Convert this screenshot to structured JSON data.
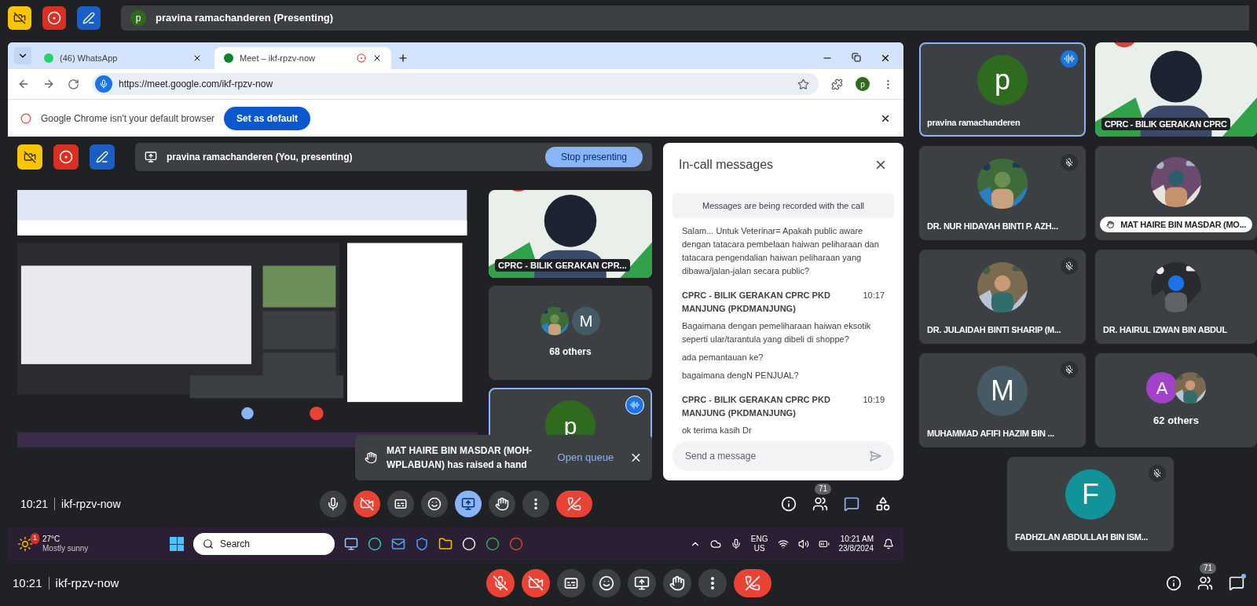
{
  "top_bar": {
    "initial": "p",
    "title": "pravina ramachanderen (Presenting)"
  },
  "browser": {
    "tabs": [
      {
        "label": "(46) WhatsApp",
        "selected": false,
        "recording": false
      },
      {
        "label": "Meet – ikf-rpzv-now",
        "selected": true,
        "recording": true
      }
    ],
    "url": "https://meet.google.com/ikf-rpzv-now",
    "profile_initial": "p",
    "infobar": {
      "text": "Google Chrome isn't your default browser",
      "button": "Set as default"
    }
  },
  "inner_meet": {
    "presenting_text": "pravina ramachanderen (You, presenting)",
    "stop_button": "Stop presenting",
    "tiles": [
      {
        "kind": "video",
        "name": "CPRC - BILIK GERAKAN CPR..."
      },
      {
        "kind": "others",
        "initial": "M",
        "color": "#455a64",
        "label": "68 others"
      },
      {
        "kind": "initial",
        "initial": "p",
        "color": "#2e6b1f",
        "speaking": true
      }
    ],
    "toast": {
      "text": "MAT HAIRE BIN MASDAR (MOH-WPLABUAN) has raised a hand",
      "action": "Open queue"
    },
    "chat": {
      "title": "In-call messages",
      "notice": "Messages are being recorded with the call",
      "messages": [
        {
          "lines": [
            "Salam... Untuk Veterinar= Apakah public aware dengan tatacara pembelaan haiwan peliharaan dan tatacara pengendalian haiwan peliharaan yang dibawa/jalan-jalan secara public?"
          ]
        },
        {
          "sender": "CPRC - BILIK GERAKAN CPRC PKD MANJUNG (PKDMANJUNG)",
          "time": "10:17",
          "lines": [
            "Bagaimana dengan pemeliharaan haiwan eksotik seperti ular/tarantula yang dibeli di shoppe?",
            "ada pemantauan ke?",
            "bagaimana dengN PENJUAL?"
          ]
        },
        {
          "sender": "CPRC - BILIK GERAKAN CPRC PKD MANJUNG (PKDMANJUNG)",
          "time": "10:19",
          "lines": [
            "ok terima kasih Dr"
          ]
        }
      ],
      "placeholder": "Send a message"
    },
    "bottom_bar": {
      "time": "10:21",
      "meeting": "ikf-rpzv-now",
      "controls": [
        {
          "kind": "mic",
          "off": false
        },
        {
          "kind": "camera",
          "off": true
        },
        {
          "kind": "captions"
        },
        {
          "kind": "emoji"
        },
        {
          "kind": "present",
          "selected": true
        },
        {
          "kind": "hand"
        },
        {
          "kind": "more"
        },
        {
          "kind": "end"
        }
      ],
      "participants_count": "71"
    }
  },
  "taskbar": {
    "weather_badge": "1",
    "temperature": "27°C",
    "condition": "Mostly sunny",
    "search": "Search",
    "language": "ENG",
    "region": "US",
    "time": "10:21 AM",
    "date": "23/8/2024"
  },
  "participants": [
    {
      "kind": "initial",
      "initial": "p",
      "color": "#2e6b1f",
      "name": "pravina ramachanderen",
      "speaking": true,
      "muted": false,
      "hand_raised": false
    },
    {
      "kind": "video",
      "name": "CPRC - BILIK GERAKAN CPRC"
    },
    {
      "name": "DR. NUR HIDAYAH BINTI P. AZH...",
      "speaking": false,
      "muted": true,
      "hand_raised": false
    },
    {
      "name": "MAT HAIRE BIN MASDAR (MO...",
      "speaking": false,
      "muted": false,
      "hand_raised": true
    },
    {
      "name": "DR. JULAIDAH BINTI SHARIP (M...",
      "speaking": false,
      "muted": true,
      "hand_raised": false
    },
    {
      "name": "DR. HAIRUL IZWAN BIN ABDUL",
      "speaking": false,
      "muted": false,
      "hand_raised": false
    },
    {
      "kind": "initial",
      "initial": "M",
      "color": "#455a64",
      "name": "MUHAMMAD AFIFI HAZIM BIN ...",
      "speaking": false,
      "muted": true,
      "hand_raised": false
    },
    {
      "kind": "others",
      "initial": "A",
      "color": "#a142c9",
      "name": "62 others"
    },
    {
      "kind": "initial",
      "initial": "F",
      "color": "#12939a",
      "name": "FADHZLAN ABDULLAH BIN ISM...",
      "speaking": false,
      "muted": true,
      "hand_raised": false
    }
  ],
  "main_bar": {
    "time": "10:21",
    "meeting": "ikf-rpzv-now",
    "controls": [
      {
        "kind": "mic",
        "off": true
      },
      {
        "kind": "camera",
        "off": true
      },
      {
        "kind": "captions"
      },
      {
        "kind": "emoji"
      },
      {
        "kind": "present",
        "selected": false
      },
      {
        "kind": "hand"
      },
      {
        "kind": "more"
      },
      {
        "kind": "end"
      }
    ],
    "participants_count": "71",
    "chat_unread": true
  }
}
